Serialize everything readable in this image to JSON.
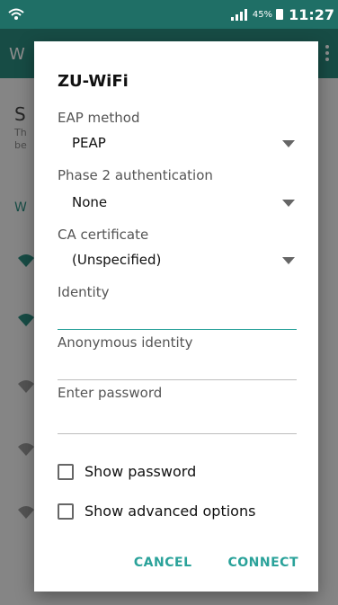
{
  "statusbar": {
    "battery_percent": "45%",
    "time": "11:27",
    "icons": [
      "wifi-icon",
      "signal-icon",
      "battery-icon"
    ]
  },
  "appbar": {
    "title_partial": "W"
  },
  "background": {
    "row1_text": "S",
    "row1_hint1": "Th",
    "row1_hint2": "be",
    "section_partial": "W"
  },
  "dialog": {
    "title": "ZU-WiFi",
    "eap_method": {
      "label": "EAP method",
      "value": "PEAP"
    },
    "phase2": {
      "label": "Phase 2 authentication",
      "value": "None"
    },
    "ca_certificate": {
      "label": "CA certificate",
      "value": "(Unspecified)"
    },
    "identity": {
      "label": "Identity",
      "value": ""
    },
    "anonymous_identity": {
      "label": "Anonymous identity",
      "value": ""
    },
    "password": {
      "label": "Enter password",
      "value": ""
    },
    "show_password": {
      "label": "Show password",
      "checked": false
    },
    "show_advanced": {
      "label": "Show advanced options",
      "checked": false
    },
    "cancel_label": "CANCEL",
    "connect_label": "CONNECT"
  },
  "colors": {
    "primary": "#2a8b7f",
    "primary_dark": "#1f6f66",
    "accent": "#2aa29a"
  }
}
